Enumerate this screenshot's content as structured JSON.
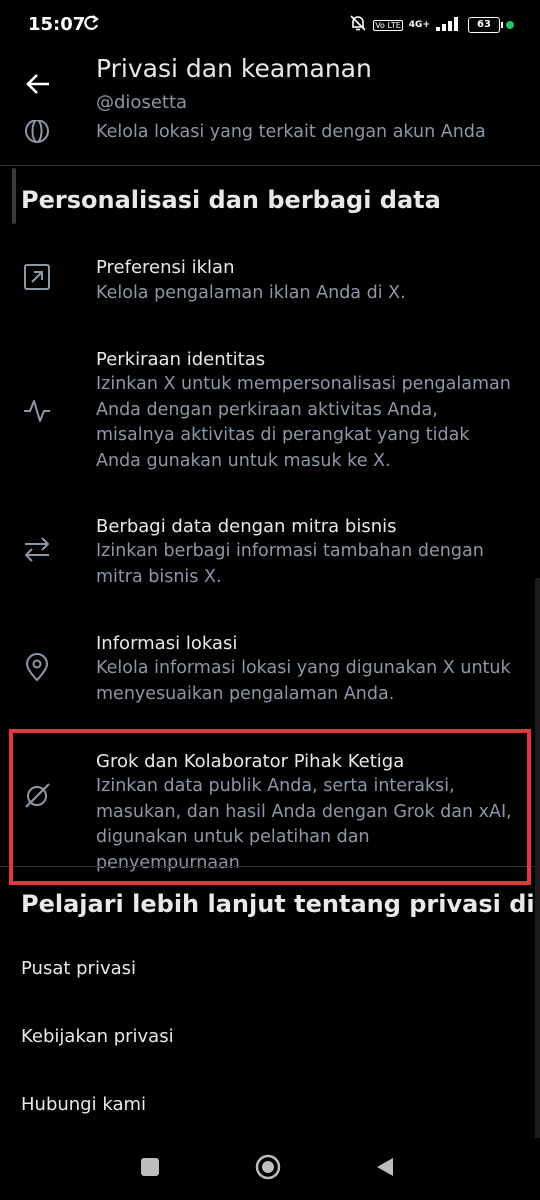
{
  "status_bar": {
    "time": "15:07",
    "network": "4G+",
    "battery": "63",
    "volte": "Vo LTE",
    "icons": [
      "sync-icon",
      "bell-off-icon",
      "signal-icon",
      "battery-icon"
    ]
  },
  "header": {
    "title": "Privasi dan keamanan",
    "handle": "@diosetta"
  },
  "top_partial_item": {
    "desc": "Kelola lokasi yang terkait dengan akun Anda",
    "icon": "globe-icon"
  },
  "section_personalization": {
    "title": "Personalisasi dan berbagi data",
    "items": [
      {
        "icon": "ad-arrow-icon",
        "title": "Preferensi iklan",
        "desc": "Kelola pengalaman iklan Anda di X."
      },
      {
        "icon": "activity-icon",
        "title": "Perkiraan identitas",
        "desc": "Izinkan X untuk mempersonalisasi pengalaman Anda dengan perkiraan aktivitas Anda, misalnya aktivitas di perangkat yang tidak Anda gunakan untuk masuk ke X."
      },
      {
        "icon": "swap-arrows-icon",
        "title": "Berbagi data dengan mitra bisnis",
        "desc": "Izinkan berbagi informasi tambahan dengan mitra bisnis X."
      },
      {
        "icon": "location-pin-icon",
        "title": "Informasi lokasi",
        "desc": "Kelola informasi lokasi yang digunakan X untuk menyesuaikan pengalaman Anda."
      },
      {
        "icon": "grok-icon",
        "title": "Grok dan Kolaborator Pihak Ketiga",
        "desc": "Izinkan data publik Anda, serta interaksi, masukan, dan hasil Anda dengan Grok dan xAI, digunakan untuk pelatihan dan penyempurnaan"
      }
    ]
  },
  "section_learn": {
    "title": "Pelajari lebih lanjut tentang privasi di X",
    "links": [
      "Pusat privasi",
      "Kebijakan privasi",
      "Hubungi kami"
    ]
  },
  "colors": {
    "background": "#000000",
    "text_primary": "#e7e9ea",
    "text_secondary": "#8b98a5",
    "highlight": "#e0383e"
  }
}
